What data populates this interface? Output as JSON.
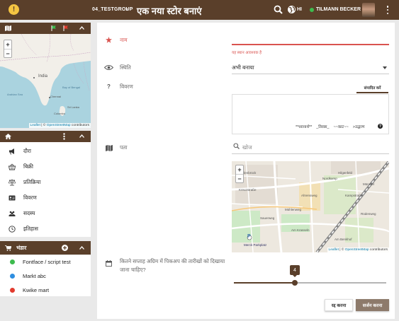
{
  "app": {
    "group": "04_TESTGROUP",
    "breadcrumb_separator": "›",
    "page_title": "एक नया स्टोर बनाएं",
    "language": "HI",
    "user_name": "TILMANN BECKER"
  },
  "colors": {
    "brand": "#5a3f2a",
    "error": "#d9534f",
    "online": "#3dbb4e"
  },
  "icons": {
    "logo": "app-logo-icon",
    "search": "search-icon",
    "language": "globe-icon",
    "menu": "kebab-menu-icon"
  },
  "overview_map": {
    "labels": [
      "India",
      "Chennai",
      "Colombo",
      "Sri Lanka",
      "Bay of Bengal",
      "Arabian Sea"
    ],
    "zoom_in": "+",
    "zoom_out": "−",
    "attribution": {
      "leaflet": "Leaflet",
      "separator": " | © ",
      "osm": "OpenStreetMap",
      "suffix": " contributors"
    }
  },
  "sidebar": {
    "nav": [
      {
        "label": "दौरा",
        "icon": "bullhorn-icon"
      },
      {
        "label": "बिक्री",
        "icon": "basket-icon"
      },
      {
        "label": "प्रतिक्रिया",
        "icon": "balance-scale-icon"
      },
      {
        "label": "विवरण",
        "icon": "id-card-icon"
      },
      {
        "label": "सदस्य",
        "icon": "users-icon"
      },
      {
        "label": "इतिहास",
        "icon": "clock-icon"
      }
    ],
    "stores_title": "भंडार",
    "stores": [
      {
        "label": "Fontface / script test",
        "color": "#3dbb4e"
      },
      {
        "label": "Markt abc",
        "color": "#2e8ee0"
      },
      {
        "label": "Kwike mart",
        "color": "#e23b2e"
      }
    ]
  },
  "form": {
    "name_label": "नाम",
    "name_value": "",
    "name_error": "यह स्थान आवश्यक है",
    "status_label": "स्थिति",
    "status_value": "अभी बनाया",
    "description_label": "विवरण",
    "edit_tab": "संपादित करें",
    "description_value": "",
    "markdown_hints": [
      "**ध्यानार्थ**",
      "_तिरछा_",
      "~~काट~~",
      ">उद्धरण"
    ],
    "markdown_help": "?",
    "address_label": "पता",
    "address_placeholder": "खोज",
    "address_map": {
      "labels": [
        "Kreuzstraße",
        "Nordkamp",
        "Hilgenfeld",
        "Mühlenweg",
        "Am Krasseln",
        "Kampstraße",
        "Merck Parkplatz",
        "Sauerweg",
        "Am Benkhof",
        "Ahrensweg",
        "Wiedenbrück",
        "Rüdenweg",
        "Münster"
      ],
      "parking": "P",
      "zoom_in": "+",
      "zoom_out": "−"
    },
    "weeks_label": "कितने सप्ताह अग्रिम में पिकअप की तारीखों को दिखाया जाना चाहिए?",
    "weeks_value": 4,
    "weeks_min": 0,
    "weeks_max": 10,
    "cancel_label": "रद्द करना",
    "create_label": "सर्जन करना"
  }
}
